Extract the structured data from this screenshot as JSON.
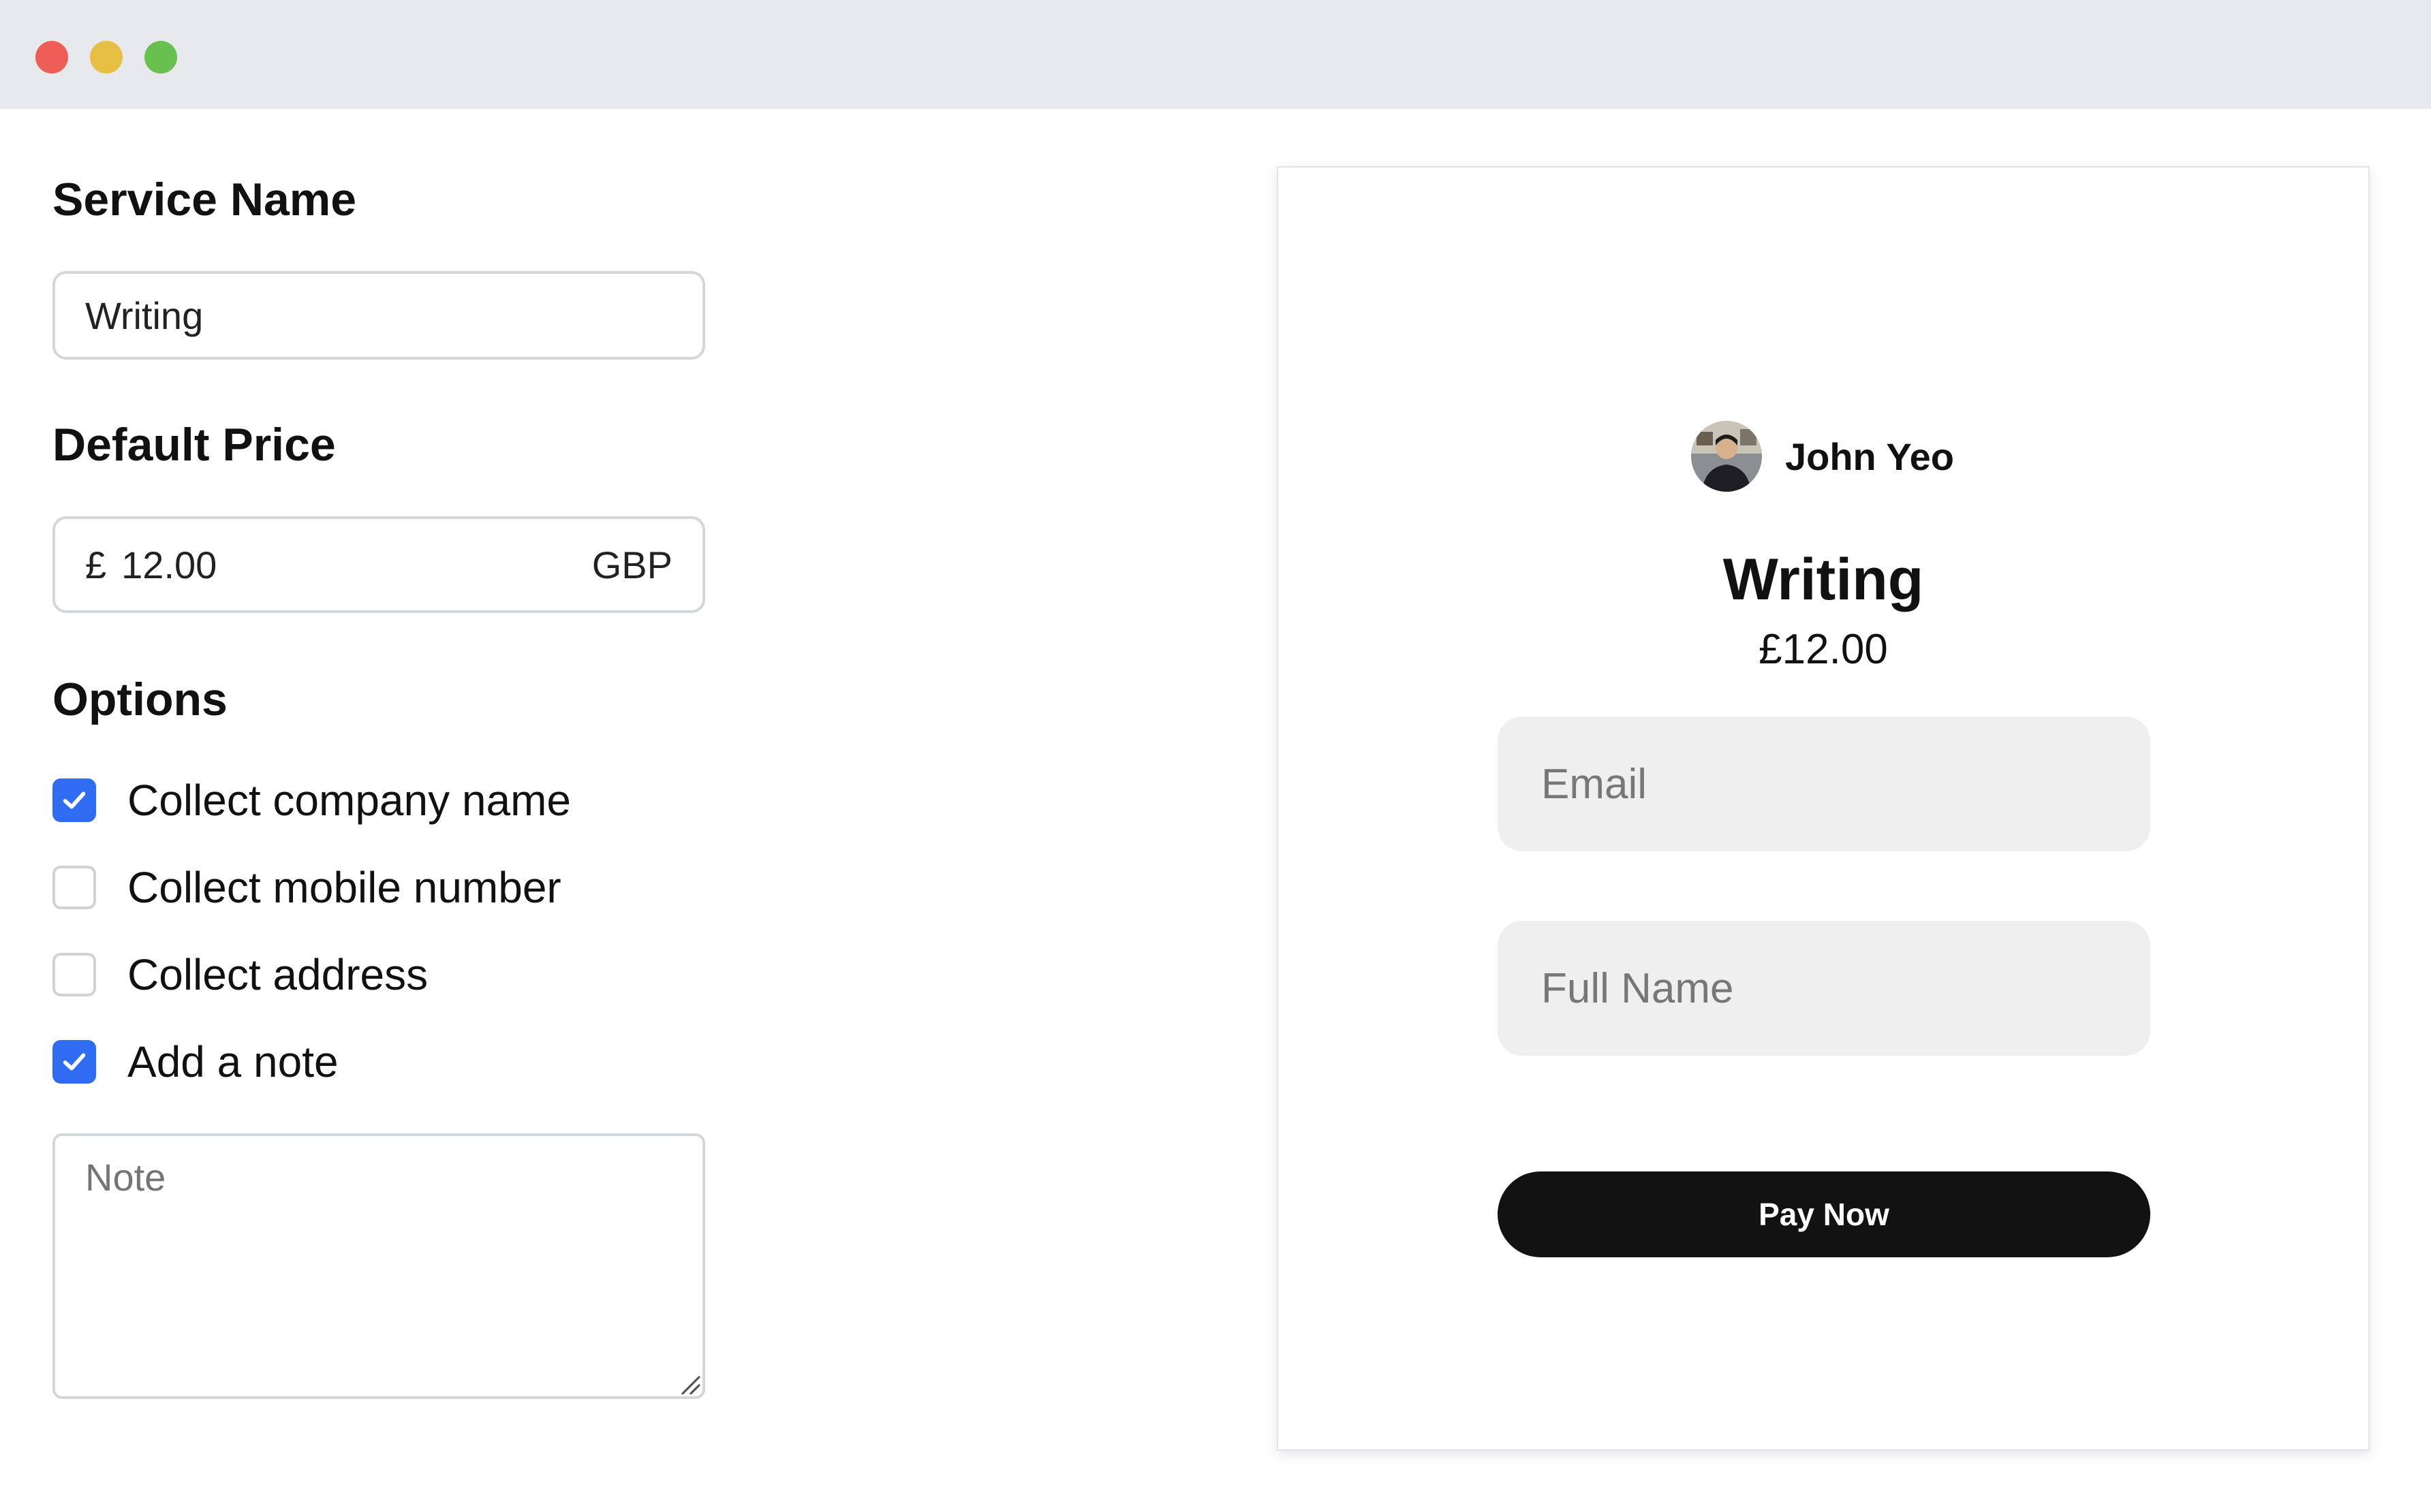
{
  "window": {
    "buttons": [
      "close",
      "minimize",
      "maximize"
    ]
  },
  "settings": {
    "service_name_label": "Service Name",
    "service_name_value": "Writing",
    "default_price_label": "Default Price",
    "currency_symbol": "£",
    "price_value": "12.00",
    "currency_code": "GBP",
    "options_label": "Options",
    "options": [
      {
        "label": "Collect company name",
        "checked": true
      },
      {
        "label": "Collect mobile number",
        "checked": false
      },
      {
        "label": "Collect address",
        "checked": false
      },
      {
        "label": "Add a note",
        "checked": true
      }
    ],
    "note_placeholder": "Note"
  },
  "preview": {
    "owner_name": "John Yeo",
    "service_title": "Writing",
    "price_display": "£12.00",
    "email_placeholder": "Email",
    "full_name_placeholder": "Full Name",
    "pay_button_label": "Pay Now"
  },
  "colors": {
    "accent": "#2f6cf1",
    "pay_button": "#121212",
    "titlebar": "#e7e9ec",
    "close": "#ed5f56",
    "minimize": "#e6bf43",
    "maximize": "#68c04f"
  }
}
